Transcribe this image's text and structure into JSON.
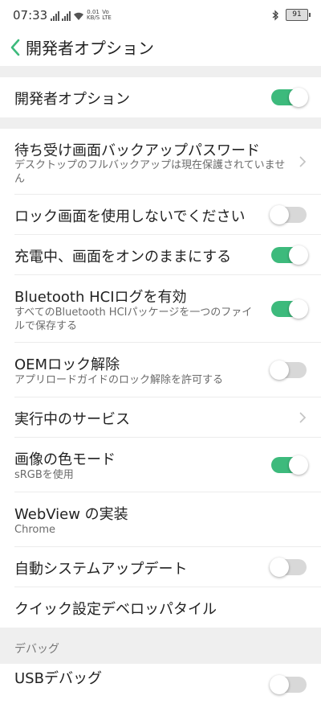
{
  "status_bar": {
    "time": "07:33",
    "net_speed": "0.01",
    "net_unit": "KB/S",
    "volte_top": "Vo",
    "volte_bottom": "LTE",
    "battery": "91"
  },
  "header": {
    "title": "開発者オプション"
  },
  "master": {
    "label": "開発者オプション",
    "on": true
  },
  "items": [
    {
      "title": "待ち受け画面バックアップパスワード",
      "subtitle": "デスクトップのフルバックアップは現在保護されていません",
      "control": "chevron"
    },
    {
      "title": "ロック画面を使用しないでください",
      "control": "toggle",
      "on": false
    },
    {
      "title": "充電中、画面をオンのままにする",
      "control": "toggle",
      "on": true
    },
    {
      "title": "Bluetooth HCIログを有効",
      "subtitle": "すべてのBluetooth HCIパッケージを一つのファイルで保存する",
      "control": "toggle",
      "on": true
    },
    {
      "title": "OEMロック解除",
      "subtitle": "アプリロードガイドのロック解除を許可する",
      "control": "toggle",
      "on": false
    },
    {
      "title": "実行中のサービス",
      "control": "chevron"
    },
    {
      "title": "画像の色モード",
      "subtitle": "sRGBを使用",
      "control": "toggle",
      "on": true
    },
    {
      "title": "WebView の実装",
      "subtitle": "Chrome",
      "control": "none"
    },
    {
      "title": "自動システムアップデート",
      "control": "toggle",
      "on": false
    },
    {
      "title": "クイック設定デベロッパタイル",
      "control": "none"
    }
  ],
  "debug_section": {
    "label": "デバッグ"
  },
  "usb_debug": {
    "title": "USBデバッグ",
    "on": false
  },
  "colors": {
    "accent": "#3dba7c",
    "toggle_off": "#d8d8d8",
    "divider": "#efefef"
  }
}
